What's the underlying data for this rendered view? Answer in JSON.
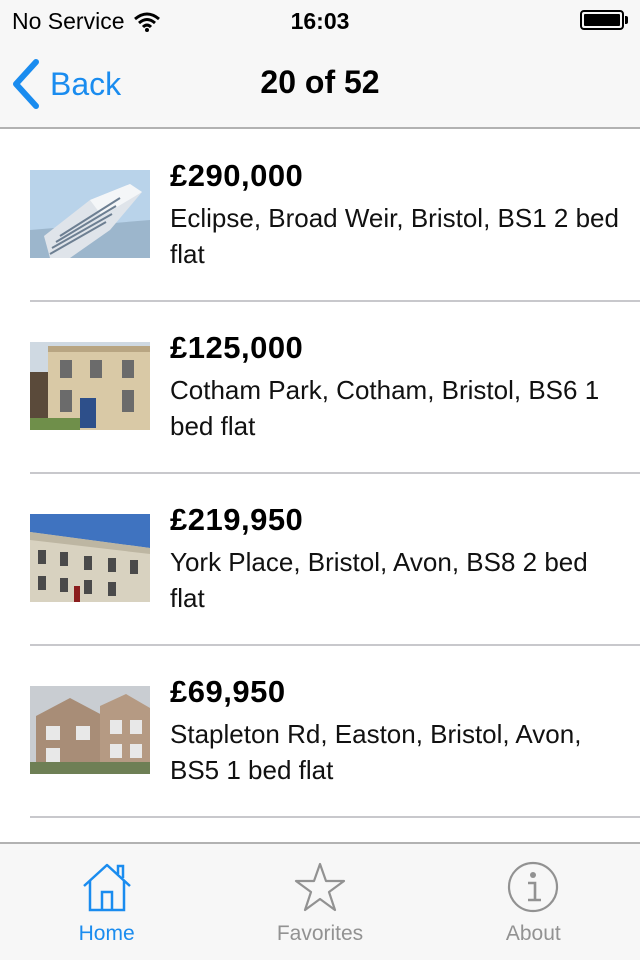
{
  "status_bar": {
    "carrier": "No Service",
    "time": "16:03",
    "wifi_icon": "wifi-icon",
    "battery_icon": "battery-icon"
  },
  "nav": {
    "back_label": "Back",
    "back_icon": "chevron-left-icon",
    "title": "20 of 52"
  },
  "listings": [
    {
      "price": "£290,000",
      "description": "Eclipse, Broad Weir, Bristol, BS1 2 bed flat",
      "image": "tower-block-photo"
    },
    {
      "price": "£125,000",
      "description": "Cotham Park, Cotham, Bristol, BS6 1 bed flat",
      "image": "georgian-house-photo"
    },
    {
      "price": "£219,950",
      "description": "York Place, Bristol, Avon, BS8 2 bed flat",
      "image": "terrace-photo"
    },
    {
      "price": "£69,950",
      "description": "Stapleton Rd, Easton, Bristol, Avon, BS5 1 bed flat",
      "image": "brick-flats-photo"
    }
  ],
  "tabs": [
    {
      "label": "Home",
      "icon": "house-icon",
      "active": true
    },
    {
      "label": "Favorites",
      "icon": "star-icon",
      "active": false
    },
    {
      "label": "About",
      "icon": "info-icon",
      "active": false
    }
  ],
  "colors": {
    "accent": "#1a8cef",
    "inactive": "#929292",
    "bar_background": "#f7f7f7"
  }
}
